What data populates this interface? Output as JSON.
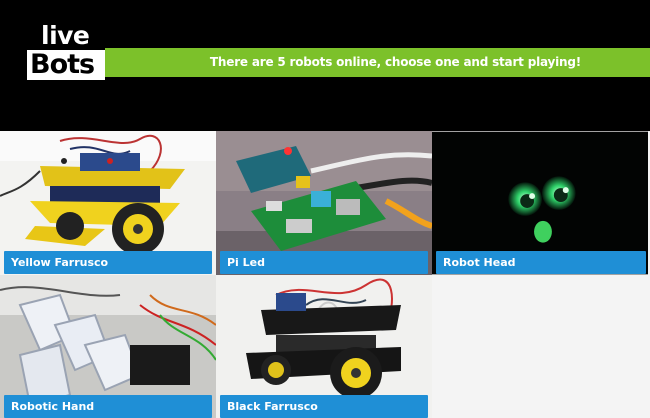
{
  "header": {
    "logo": {
      "line1": "live",
      "line2": "Bots"
    },
    "banner_text": "There are 5 robots online, choose one and start playing!"
  },
  "robots": [
    {
      "label": "Yellow Farrusco",
      "icon": "robot-car-photo"
    },
    {
      "label": "Pi Led",
      "icon": "raspberry-pi-photo"
    },
    {
      "label": "Robot Head",
      "icon": "robot-head-photo"
    },
    {
      "label": "Robotic Hand",
      "icon": "robotic-hand-photo"
    },
    {
      "label": "Black Farrusco",
      "icon": "robot-car-photo"
    }
  ],
  "colors": {
    "header_bg": "#000000",
    "banner_green": "#7cc12a",
    "label_blue": "#1f8fd6",
    "page_bg": "#f4f4f4"
  }
}
